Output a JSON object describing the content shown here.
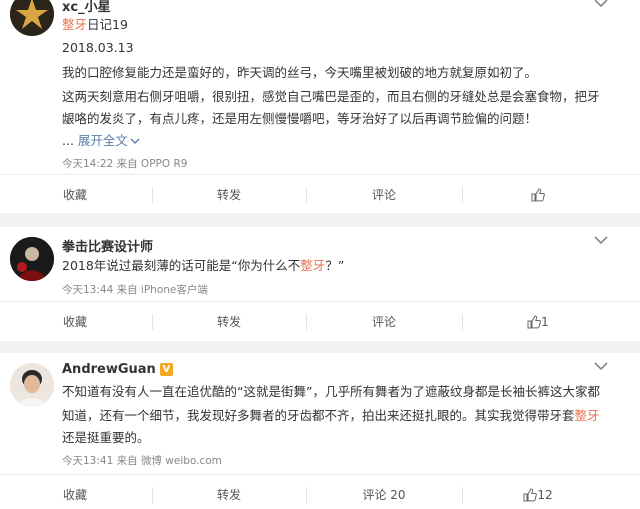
{
  "post1": {
    "username": "xc_小星",
    "title_keyword": "整牙",
    "title_rest": "日记19",
    "date": "2018.03.13",
    "lines": [
      "我的口腔修复能力还是蛮好的，昨天调的丝弓，今天嘴里被划破的地方就复原如初了。",
      "这两天刻意用右侧牙咀嚼，很别扭，感觉自己嘴巴是歪的，而且右侧的牙缝处总是会塞食物，把牙",
      "龈咯的发炎了，有点儿疼，还是用左侧慢慢嚼吧，等牙治好了以后再调节脸偏的问题！"
    ],
    "ellipsis": "...",
    "expand": "展开全文",
    "meta": "今天14:22 来自 OPPO R9",
    "actions": {
      "fav": "收藏",
      "repost": "转发",
      "comment": "评论",
      "like": ""
    }
  },
  "post2": {
    "username": "拳击比赛设计师",
    "text_before": "2018年说过最刻薄的话可能是“你为什么不",
    "text_keyword": "整牙",
    "text_after": "？”",
    "meta": "今天13:44 来自 iPhone客户端",
    "actions": {
      "fav": "收藏",
      "repost": "转发",
      "comment": "评论",
      "like": "1"
    }
  },
  "post3": {
    "username": "AndrewGuan",
    "verified": "V",
    "lines": [
      "不知道有没有人一直在追优酷的“这就是街舞”，几乎所有舞者为了遮蔽纹身都是长袖长裤这大家都",
      "知道，还有一个细节，我发现好多舞者的牙齿都不齐，拍出来还挺扎眼的。其实我觉得带牙套"
    ],
    "line2_keyword": "整牙",
    "line3": "还是挺重要的。",
    "meta_prefix": "今天13:41 来自 ",
    "meta_source": "微博 weibo.com",
    "actions": {
      "fav": "收藏",
      "repost": "转发",
      "comment": "评论 20",
      "like": "12"
    }
  },
  "colors": {
    "keyword": "#eb7350",
    "background_gap": "#f2f2f5"
  }
}
